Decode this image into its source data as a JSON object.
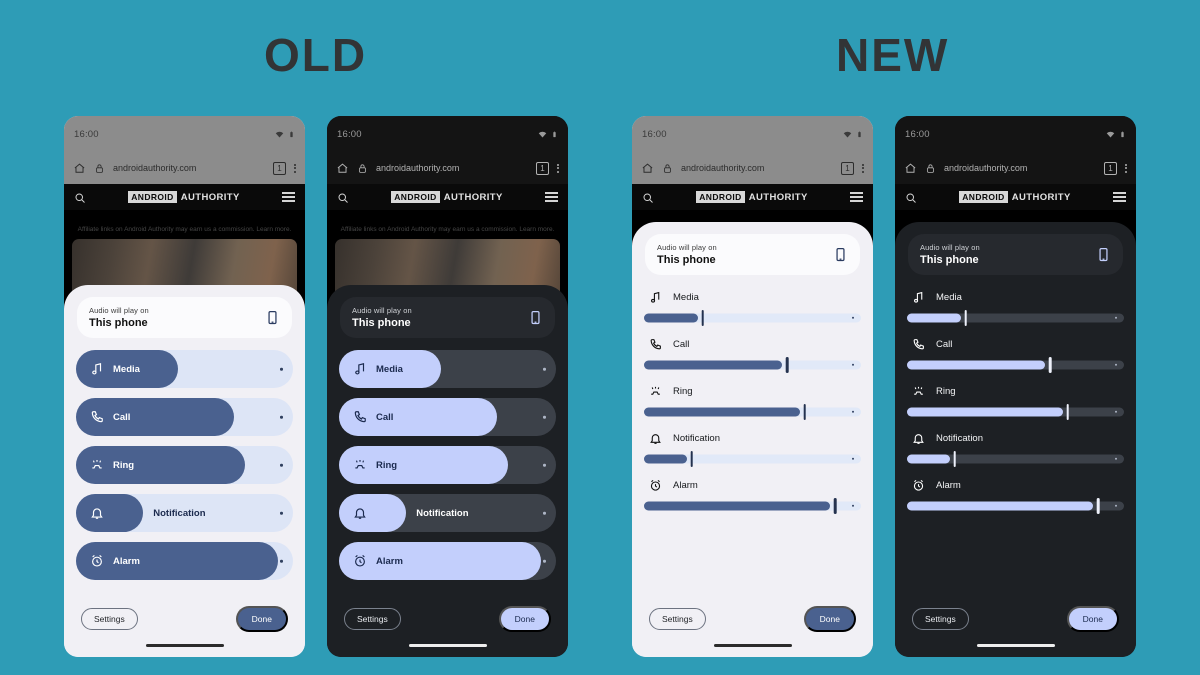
{
  "headings": {
    "old": "OLD",
    "new": "NEW"
  },
  "background_color": "#2e9cb6",
  "status_bar": {
    "time": "16:00",
    "wifi_icon": "wifi-icon",
    "battery_icon": "battery-icon"
  },
  "browser": {
    "home_icon": "home-icon",
    "lock_icon": "lock-icon",
    "url": "androidauthority.com",
    "tab_count": "1",
    "menu_icon": "kebab-menu-icon"
  },
  "site_header": {
    "search_icon": "search-icon",
    "logo_boxed": "ANDROID",
    "logo_plain": "AUTHORITY",
    "menu_icon": "hamburger-icon"
  },
  "site_body": {
    "affiliate_notice": "Affiliate links on Android Authority may earn us a commission. Learn more."
  },
  "output_card": {
    "label": "Audio will play on",
    "value": "This phone",
    "device_icon": "phone-icon"
  },
  "sliders": [
    {
      "name": "Media",
      "icon": "music-note-icon",
      "old_fill_pct": 47,
      "new_fill_pct": 27
    },
    {
      "name": "Call",
      "icon": "phone-call-icon",
      "old_fill_pct": 73,
      "new_fill_pct": 66
    },
    {
      "name": "Ring",
      "icon": "vibrate-ring-icon",
      "old_fill_pct": 78,
      "new_fill_pct": 74
    },
    {
      "name": "Notification",
      "icon": "bell-icon",
      "old_fill_pct": 31,
      "new_fill_pct": 22
    },
    {
      "name": "Alarm",
      "icon": "alarm-clock-icon",
      "old_fill_pct": 93,
      "new_fill_pct": 88
    }
  ],
  "footer": {
    "settings_label": "Settings",
    "done_label": "Done"
  },
  "panels": [
    {
      "id": "phone-1",
      "theme": "light",
      "design": "old",
      "group": "OLD"
    },
    {
      "id": "phone-2",
      "theme": "dark",
      "design": "old",
      "group": "OLD"
    },
    {
      "id": "phone-3",
      "theme": "light",
      "design": "new",
      "group": "NEW"
    },
    {
      "id": "phone-4",
      "theme": "dark",
      "design": "new",
      "group": "NEW"
    }
  ],
  "colors": {
    "accent_light_fill": "#4a618f",
    "accent_light_track": "#dde5f6",
    "accent_dark_fill": "#c3cffc",
    "accent_dark_track": "#3c4149",
    "sheet_light": "#f1f0f5",
    "sheet_dark": "#1d2024"
  }
}
